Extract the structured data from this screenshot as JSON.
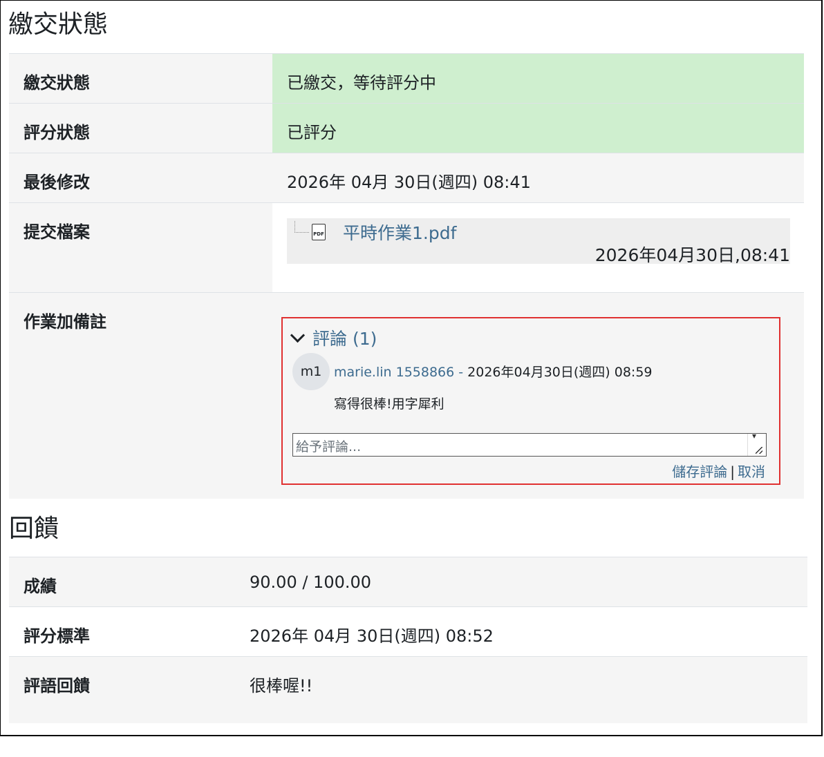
{
  "submission": {
    "title": "繳交狀態",
    "rows": {
      "status_label": "繳交狀態",
      "status_value": "已繳交，等待評分中",
      "grading_label": "評分狀態",
      "grading_value": "已評分",
      "modified_label": "最後修改",
      "modified_value": "2026年 04月 30日(週四) 08:41",
      "files_label": "提交檔案",
      "notes_label": "作業加備註"
    },
    "file": {
      "icon": "pdf-icon",
      "name": "平時作業1.pdf",
      "date": "2026年04月30日,08:41"
    },
    "comments": {
      "toggle_label": "評論 (1)",
      "items": [
        {
          "avatar_initials": "m1",
          "author": "marie.lin 1558866",
          "separator": " - ",
          "date": "2026年04月30日(週四) 08:59",
          "text": "寫得很棒!用字犀利"
        }
      ],
      "input_placeholder": "給予評論...",
      "save_label": "儲存評論",
      "divider": "|",
      "cancel_label": "取消"
    }
  },
  "feedback": {
    "title": "回饋",
    "rows": {
      "grade_label": "成績",
      "grade_value": "90.00 / 100.00",
      "graded_on_label": "評分標準",
      "graded_on_value": "2026年 04月 30日(週四) 08:52",
      "comment_label": "評語回饋",
      "comment_value": "很棒喔!!"
    }
  },
  "colors": {
    "submitted_bg": "#cfefcf",
    "link": "#3d6b8f",
    "highlight_border": "#e03030"
  }
}
